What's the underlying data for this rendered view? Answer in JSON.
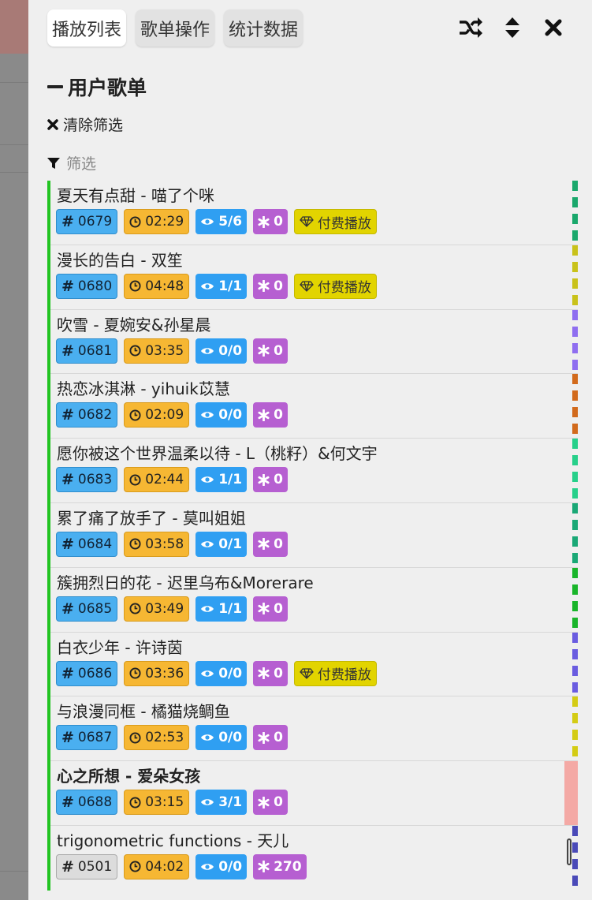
{
  "tabs": [
    {
      "label": "播放列表",
      "active": true
    },
    {
      "label": "歌单操作",
      "active": false
    },
    {
      "label": "统计数据",
      "active": false
    }
  ],
  "toolbar_icons": [
    "shuffle-icon",
    "sort-icon",
    "close-icon"
  ],
  "section": {
    "title": "用户歌单"
  },
  "clear_filter": {
    "label": "清除筛选"
  },
  "filter": {
    "placeholder": "筛选"
  },
  "pay_label": "付费播放",
  "songs": [
    {
      "title": "夏天有点甜 - 喵了个咪",
      "id": "0679",
      "duration": "02:29",
      "views": "5/6",
      "stars": "0",
      "paid": true,
      "color": "#1aa86c"
    },
    {
      "title": "漫长的告白 - 双笙",
      "id": "0680",
      "duration": "04:48",
      "views": "1/1",
      "stars": "0",
      "paid": true,
      "color": "#c9c21a"
    },
    {
      "title": "吹雪 - 夏婉安&孙星晨",
      "id": "0681",
      "duration": "03:35",
      "views": "0/0",
      "stars": "0",
      "paid": false,
      "color": "#8f6ef0"
    },
    {
      "title": "热恋冰淇淋 - yihuik苡慧",
      "id": "0682",
      "duration": "02:09",
      "views": "0/0",
      "stars": "0",
      "paid": false,
      "color": "#d26a1c"
    },
    {
      "title": "愿你被这个世界温柔以待 - L（桃籽）&何文宇",
      "id": "0683",
      "duration": "02:44",
      "views": "1/1",
      "stars": "0",
      "paid": false,
      "color": "#27d08a"
    },
    {
      "title": "累了痛了放手了 - 莫叫姐姐",
      "id": "0684",
      "duration": "03:58",
      "views": "0/1",
      "stars": "0",
      "paid": false,
      "color": "#1aa876"
    },
    {
      "title": "簇拥烈日的花 - 迟里乌布&Morerare",
      "id": "0685",
      "duration": "03:49",
      "views": "1/1",
      "stars": "0",
      "paid": false,
      "color": "#19b52a"
    },
    {
      "title": "白衣少年 - 许诗茵",
      "id": "0686",
      "duration": "03:36",
      "views": "0/0",
      "stars": "0",
      "paid": true,
      "color": "#6a5ce0"
    },
    {
      "title": "与浪漫同框 - 橘猫烧鲷鱼",
      "id": "0687",
      "duration": "02:53",
      "views": "0/0",
      "stars": "0",
      "paid": false,
      "color": "#d4cc14"
    },
    {
      "title": "心之所想 - 爱朵女孩",
      "id": "0688",
      "duration": "03:15",
      "views": "3/1",
      "stars": "0",
      "paid": false,
      "current": true,
      "color": "#f4a9a5"
    },
    {
      "title": "trigonometric functions - 天儿",
      "id": "0501",
      "duration": "04:02",
      "views": "0/0",
      "stars": "270",
      "paid": false,
      "gray": true,
      "color": "#4a4ab8"
    }
  ]
}
